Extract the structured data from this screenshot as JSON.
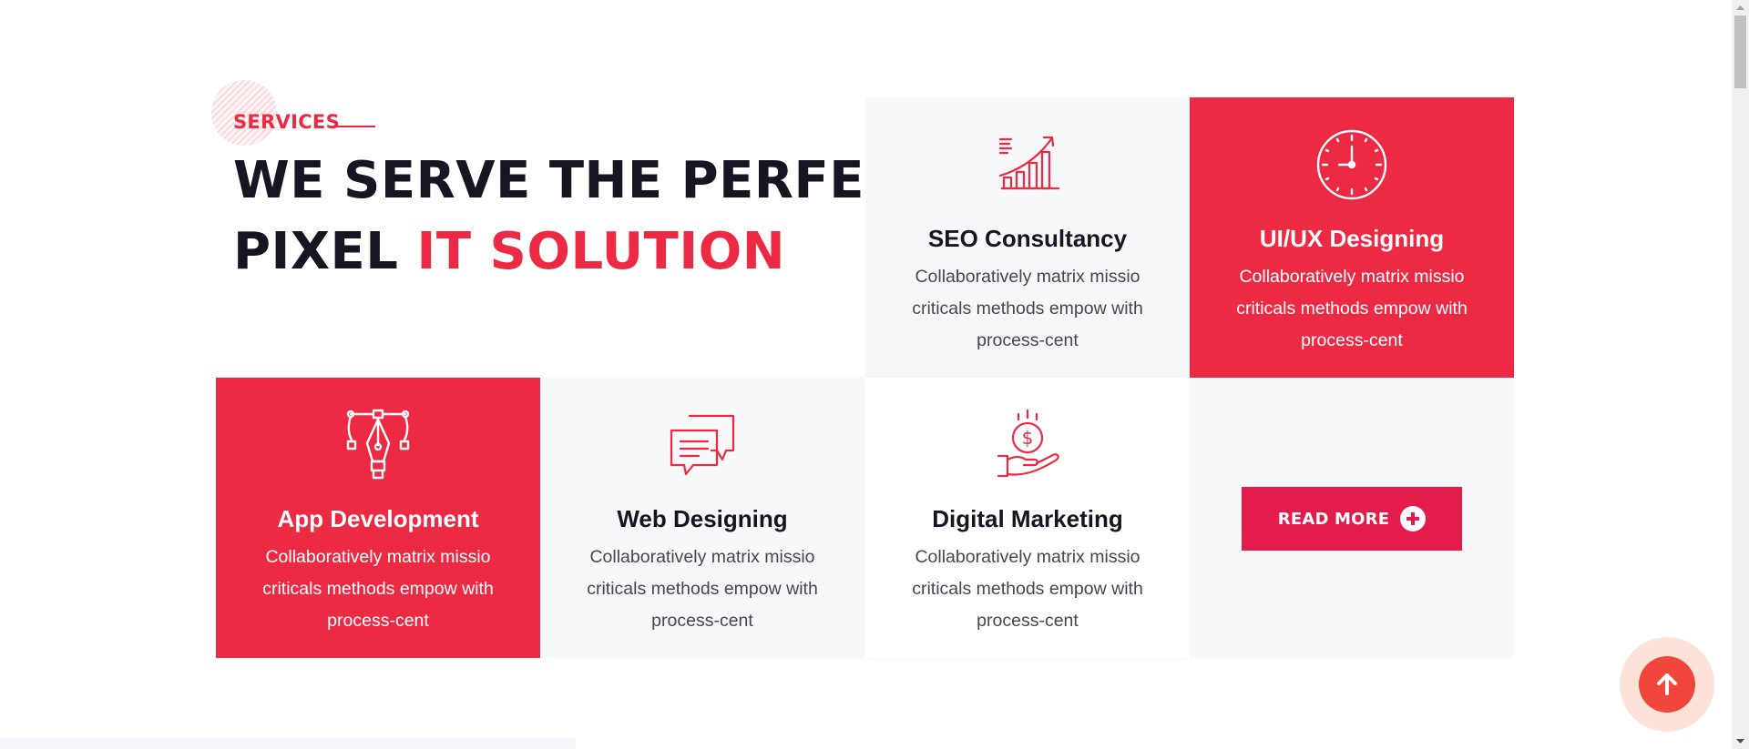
{
  "section": {
    "subtitle": "SERVICES",
    "title_line1": "WE SERVE THE PERFECT",
    "title_line2_prefix": "PIXEL ",
    "title_line2_accent": "IT SOLUTION"
  },
  "services": [
    {
      "title": "SEO Consultancy",
      "desc": "Collaboratively matrix missio criticals methods empow with process-cent",
      "icon": "growth-chart-icon"
    },
    {
      "title": "UI/UX Designing",
      "desc": "Collaboratively matrix missio criticals methods empow with process-cent",
      "icon": "clock-icon"
    },
    {
      "title": "App Development",
      "desc": "Collaboratively matrix missio criticals methods empow with process-cent",
      "icon": "pen-tool-icon"
    },
    {
      "title": "Web Designing",
      "desc": "Collaboratively matrix missio criticals methods empow with process-cent",
      "icon": "chat-bubbles-icon"
    },
    {
      "title": "Digital Marketing",
      "desc": "Collaboratively matrix missio criticals methods empow with process-cent",
      "icon": "money-hand-icon"
    }
  ],
  "read_more": {
    "label": "READ MORE",
    "icon": "plus-circle-icon"
  },
  "back_to_top": {
    "icon": "arrow-up-icon"
  },
  "colors": {
    "accent": "#ec2a44",
    "heading": "#161623",
    "body_text": "#444752",
    "card_light_bg": "#f7f8fa",
    "button": "#e31c4b",
    "back_to_top": "#f0463c",
    "back_to_top_halo": "#fde3d7"
  }
}
